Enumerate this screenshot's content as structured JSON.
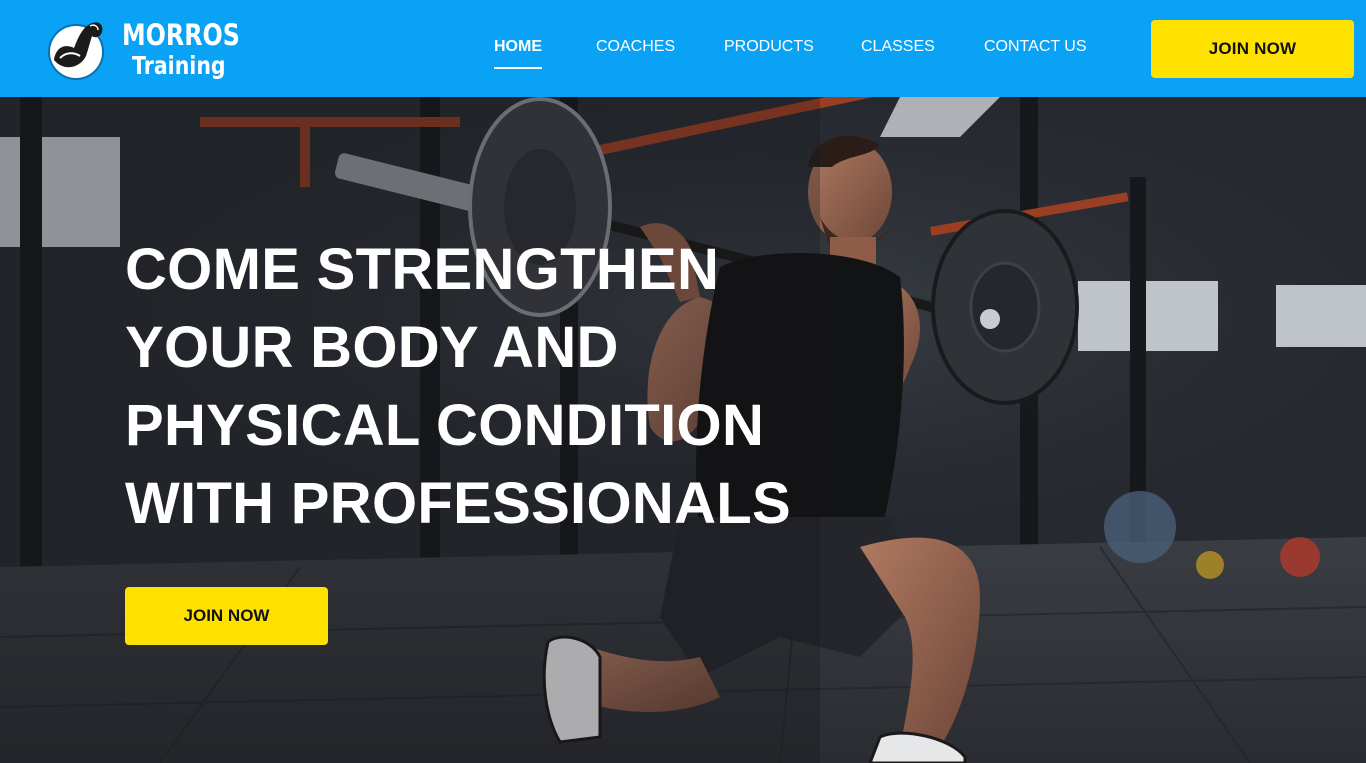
{
  "brand": {
    "name_line1": "MORROS",
    "name_line2": "Training",
    "logo_icon": "flexed-arm-icon"
  },
  "nav": {
    "items": [
      {
        "label": "HOME",
        "active": true
      },
      {
        "label": "COACHES",
        "active": false
      },
      {
        "label": "PRODUCTS",
        "active": false
      },
      {
        "label": "CLASSES",
        "active": false
      },
      {
        "label": "CONTACT US",
        "active": false
      }
    ]
  },
  "header": {
    "cta_label": "JOIN NOW"
  },
  "hero": {
    "title_lines": [
      "COME STRENGTHEN",
      "YOUR BODY AND",
      "PHYSICAL CONDITION",
      "WITH PROFESSIONALS"
    ],
    "cta_label": "JOIN NOW",
    "image": "athlete-lunge-with-barbell-photo"
  },
  "colors": {
    "header_bg": "#0aa2f5",
    "accent": "#ffe100",
    "text_light": "#ffffff",
    "hero_bg": "#23262c"
  }
}
